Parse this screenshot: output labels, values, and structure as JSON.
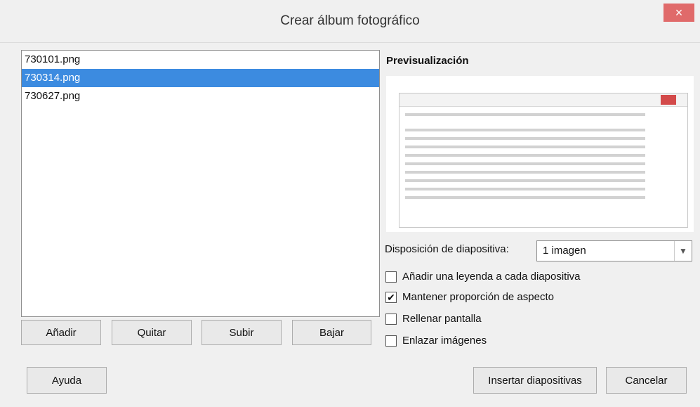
{
  "window": {
    "title": "Crear álbum fotográfico",
    "close_glyph": "×"
  },
  "files": [
    "730101.png",
    "730314.png",
    "730627.png"
  ],
  "selected_index": 1,
  "list_buttons": {
    "add": "Añadir",
    "remove": "Quitar",
    "up": "Subir",
    "down": "Bajar"
  },
  "preview": {
    "label": "Previsualización"
  },
  "layout": {
    "label": "Disposición de diapositiva:",
    "value": "1 imagen"
  },
  "options": [
    {
      "label": "Añadir una leyenda a cada diapositiva",
      "checked": false
    },
    {
      "label": "Mantener proporción de aspecto",
      "checked": true
    },
    {
      "label": "Rellenar pantalla",
      "checked": false
    },
    {
      "label": "Enlazar imágenes",
      "checked": false
    }
  ],
  "footer": {
    "help": "Ayuda",
    "insert": "Insertar diapositivas",
    "cancel": "Cancelar"
  },
  "colors": {
    "selection": "#3c8be0",
    "close_bg": "#e06a6a"
  }
}
